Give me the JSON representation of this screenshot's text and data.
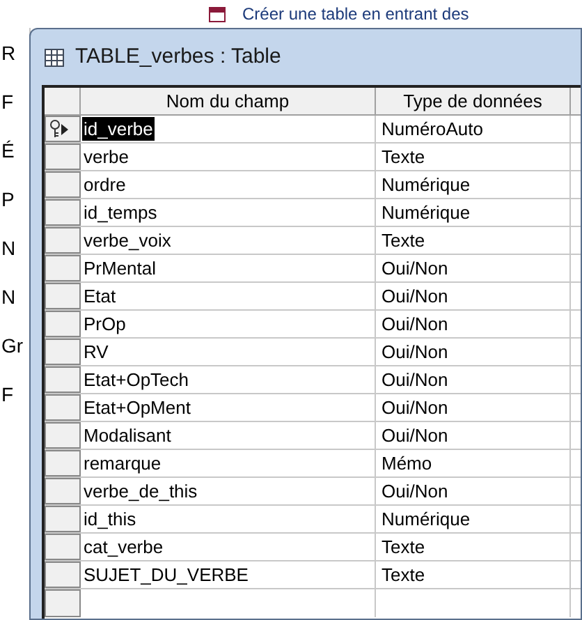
{
  "background": {
    "heading": "Créer une table en entrant des",
    "sidebar_items": [
      "R",
      "F",
      "É",
      "P",
      "N",
      "N",
      "Gr",
      "F"
    ]
  },
  "window": {
    "title": "TABLE_verbes : Table"
  },
  "table": {
    "columns": [
      "Nom du champ",
      "Type de données"
    ],
    "rows": [
      {
        "name": "id_verbe",
        "type": "NuméroAuto",
        "primary_key": true,
        "current": true
      },
      {
        "name": "verbe",
        "type": "Texte",
        "primary_key": false,
        "current": false
      },
      {
        "name": "ordre",
        "type": "Numérique",
        "primary_key": false,
        "current": false
      },
      {
        "name": "id_temps",
        "type": "Numérique",
        "primary_key": false,
        "current": false
      },
      {
        "name": "verbe_voix",
        "type": "Texte",
        "primary_key": false,
        "current": false
      },
      {
        "name": "PrMental",
        "type": "Oui/Non",
        "primary_key": false,
        "current": false
      },
      {
        "name": "Etat",
        "type": "Oui/Non",
        "primary_key": false,
        "current": false
      },
      {
        "name": "PrOp",
        "type": "Oui/Non",
        "primary_key": false,
        "current": false
      },
      {
        "name": "RV",
        "type": "Oui/Non",
        "primary_key": false,
        "current": false
      },
      {
        "name": "Etat+OpTech",
        "type": "Oui/Non",
        "primary_key": false,
        "current": false
      },
      {
        "name": "Etat+OpMent",
        "type": "Oui/Non",
        "primary_key": false,
        "current": false
      },
      {
        "name": "Modalisant",
        "type": "Oui/Non",
        "primary_key": false,
        "current": false
      },
      {
        "name": "remarque",
        "type": "Mémo",
        "primary_key": false,
        "current": false
      },
      {
        "name": "verbe_de_this",
        "type": "Oui/Non",
        "primary_key": false,
        "current": false
      },
      {
        "name": "id_this",
        "type": "Numérique",
        "primary_key": false,
        "current": false
      },
      {
        "name": "cat_verbe",
        "type": "Texte",
        "primary_key": false,
        "current": false
      },
      {
        "name": "SUJET_DU_VERBE",
        "type": "Texte",
        "primary_key": false,
        "current": false
      }
    ]
  }
}
